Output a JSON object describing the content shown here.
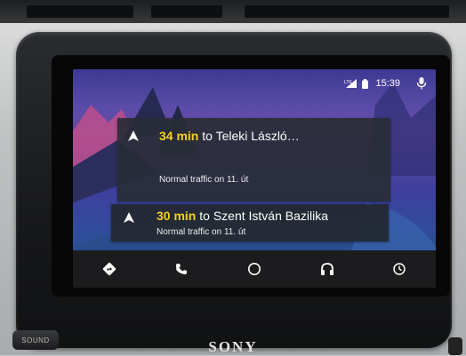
{
  "status_bar": {
    "time": "15:39",
    "icons": [
      "signal-lte-icon",
      "battery-icon",
      "microphone-icon"
    ]
  },
  "cards": [
    {
      "icon": "navigation-arrow-icon",
      "eta": "34 min",
      "destination": "to Teleki László…",
      "traffic": "Normal traffic on 11. út"
    },
    {
      "icon": "navigation-arrow-icon",
      "eta": "30 min",
      "destination": "to Szent István Bazilika",
      "traffic": "Normal traffic on 11. út"
    }
  ],
  "bottom_nav": {
    "items": [
      "navigation-icon",
      "phone-icon",
      "home-icon",
      "headphones-icon",
      "recents-icon"
    ]
  },
  "hardware": {
    "sound_label": "SOUND",
    "brand": "SONY"
  },
  "colors": {
    "eta_accent": "#f3d21a",
    "card_bg": "#282c36",
    "bottom_bar": "#1c1c1e"
  }
}
